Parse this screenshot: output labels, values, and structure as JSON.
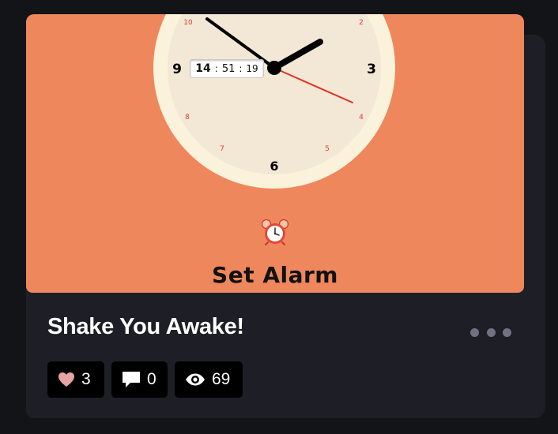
{
  "pen": {
    "title": "Shake You Awake!",
    "preview": {
      "clock": {
        "face_numbers": {
          "n3": "3",
          "n6": "6",
          "n9": "9",
          "n2": "2",
          "n4": "4",
          "n5": "5",
          "n7": "7",
          "n8": "8",
          "n10": "10"
        },
        "digital": {
          "hours": "14",
          "minutes": "51",
          "seconds": "19",
          "separator": ":"
        }
      },
      "alarm_icon": "alarm-clock-icon",
      "set_alarm_label": "Set Alarm"
    },
    "stats": {
      "hearts": "3",
      "comments": "0",
      "views": "69"
    },
    "colors": {
      "preview_background": "#ef875c",
      "clock_rim": "#fbf2dc",
      "clock_face": "#f3e7d6",
      "second_hand": "#e03224",
      "small_numbers": "#d9432e",
      "heart": "#e8a3a3",
      "card_background": "#1e1f26",
      "page_background": "#131417",
      "more_dots": "#6f7185"
    }
  }
}
